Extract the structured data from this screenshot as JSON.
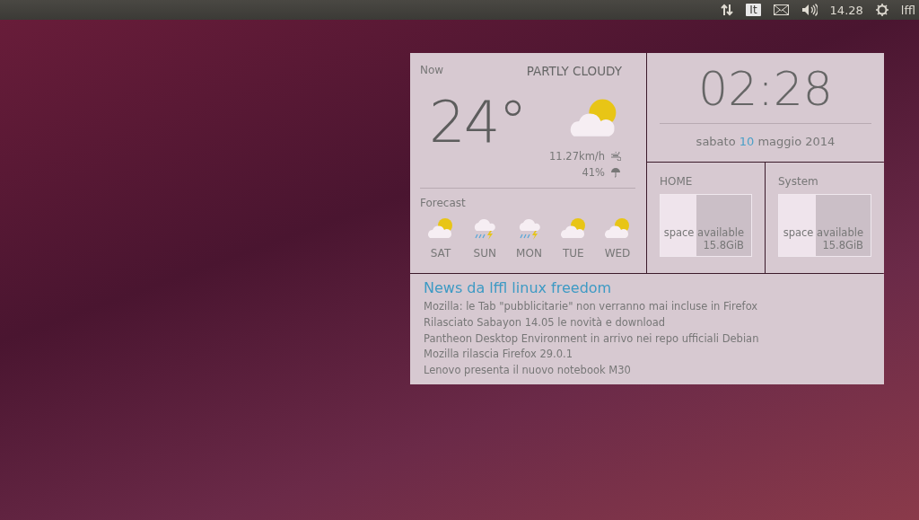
{
  "top_panel": {
    "keyboard_layout": "It",
    "time": "14.28",
    "user": "lffl"
  },
  "weather": {
    "now_label": "Now",
    "condition": "PARTLY CLOUDY",
    "temperature": "24°",
    "wind": "11.27km/h",
    "humidity": "41%",
    "forecast_label": "Forecast",
    "forecast": [
      {
        "day": "SAT",
        "kind": "partly-cloudy"
      },
      {
        "day": "SUN",
        "kind": "storm"
      },
      {
        "day": "MON",
        "kind": "storm"
      },
      {
        "day": "TUE",
        "kind": "partly-cloudy"
      },
      {
        "day": "WED",
        "kind": "partly-cloudy"
      }
    ]
  },
  "clock": {
    "time": "02:28",
    "weekday": "sabato",
    "day": "10",
    "month_year": "maggio 2014"
  },
  "disks": [
    {
      "name": "HOME",
      "label": "space available",
      "size": "15.8GiB",
      "level": 0.4
    },
    {
      "name": "System",
      "label": "space available",
      "size": "15.8GiB",
      "level": 0.4
    }
  ],
  "news": {
    "title": "News da lffl linux freedom",
    "items": [
      "Mozilla: le Tab \"pubblicitarie\" non verranno mai incluse in Firefox",
      "Rilasciato Sabayon 14.05 le novità e download",
      "Pantheon Desktop Environment in arrivo nei repo ufficiali Debian",
      "Mozilla rilascia Firefox 29.0.1",
      "Lenovo presenta il nuovo notebook M30"
    ]
  }
}
